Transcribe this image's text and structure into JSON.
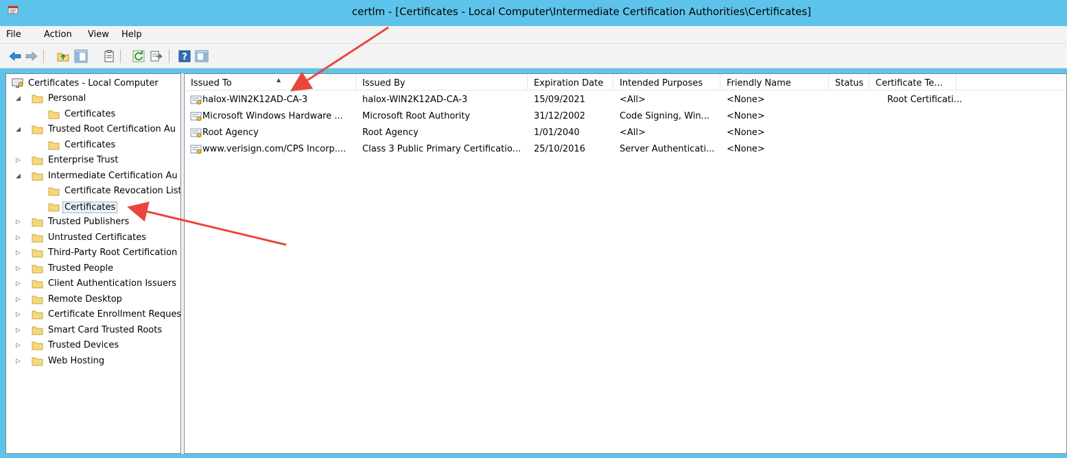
{
  "window": {
    "title": "certlm - [Certificates - Local Computer\\Intermediate Certification Authorities\\Certificates]"
  },
  "menu": {
    "file": "File",
    "action": "Action",
    "view": "View",
    "help": "Help"
  },
  "toolbar": {
    "icons": [
      "back-arrow-icon",
      "forward-arrow-icon",
      "up-folder-icon",
      "show-hide-console-tree-icon",
      "properties-icon",
      "refresh-icon",
      "export-list-icon",
      "help-icon",
      "show-hide-action-pane-icon"
    ]
  },
  "tree": {
    "root": "Certificates - Local Computer",
    "items": [
      {
        "label": "Personal",
        "state": "expanded"
      },
      {
        "label": "Certificates",
        "state": "leaf"
      },
      {
        "label": "Trusted Root Certification Au",
        "state": "expanded"
      },
      {
        "label": "Certificates",
        "state": "leaf"
      },
      {
        "label": "Enterprise Trust",
        "state": "collapsed"
      },
      {
        "label": "Intermediate Certification Au",
        "state": "expanded"
      },
      {
        "label": "Certificate Revocation List",
        "state": "leaf"
      },
      {
        "label": "Certificates",
        "state": "leaf-selected"
      },
      {
        "label": "Trusted Publishers",
        "state": "collapsed"
      },
      {
        "label": "Untrusted Certificates",
        "state": "collapsed"
      },
      {
        "label": "Third-Party Root Certification",
        "state": "collapsed"
      },
      {
        "label": "Trusted People",
        "state": "collapsed"
      },
      {
        "label": "Client Authentication Issuers",
        "state": "collapsed"
      },
      {
        "label": "Remote Desktop",
        "state": "collapsed"
      },
      {
        "label": "Certificate Enrollment Reques",
        "state": "collapsed"
      },
      {
        "label": "Smart Card Trusted Roots",
        "state": "collapsed"
      },
      {
        "label": "Trusted Devices",
        "state": "collapsed"
      },
      {
        "label": "Web Hosting",
        "state": "collapsed"
      }
    ]
  },
  "list": {
    "columns": [
      "Issued To",
      "Issued By",
      "Expiration Date",
      "Intended Purposes",
      "Friendly Name",
      "Status",
      "Certificate Te..."
    ],
    "sorted_column": "Issued To",
    "rows": [
      [
        "halox-WIN2K12AD-CA-3",
        "halox-WIN2K12AD-CA-3",
        "15/09/2021",
        "<All>",
        "<None>",
        "",
        "Root Certificati..."
      ],
      [
        "Microsoft Windows Hardware ...",
        "Microsoft Root Authority",
        "31/12/2002",
        "Code Signing, Win...",
        "<None>",
        "",
        ""
      ],
      [
        "Root Agency",
        "Root Agency",
        "1/01/2040",
        "<All>",
        "<None>",
        "",
        ""
      ],
      [
        "www.verisign.com/CPS Incorp....",
        "Class 3 Public Primary Certificatio...",
        "25/10/2016",
        "Server Authenticati...",
        "<None>",
        "",
        ""
      ]
    ]
  },
  "colors": {
    "titlebar": "#5ec3ea",
    "annotation_arrow": "#e8473f",
    "folder": "#f6d87c"
  }
}
